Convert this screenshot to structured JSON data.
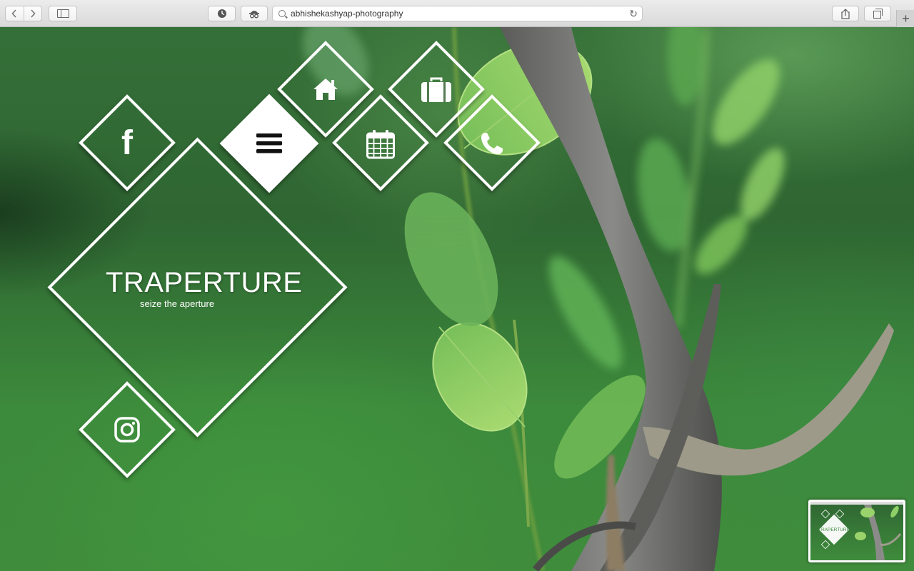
{
  "browser": {
    "url": "abhishekashyap-photography",
    "back_icon": "chevron-left-icon",
    "forward_icon": "chevron-right-icon",
    "new_tab_label": "+",
    "reload_glyph": "↻"
  },
  "site": {
    "title": "TRAPERTURE",
    "tagline": "seize the aperture",
    "thumbnail_title": "TRAPERTURE"
  },
  "nav": [
    {
      "name": "home",
      "icon": "home-icon"
    },
    {
      "name": "portfolio",
      "icon": "briefcase-icon"
    },
    {
      "name": "menu",
      "icon": "hamburger-menu-icon",
      "active": true
    },
    {
      "name": "events",
      "icon": "calendar-icon"
    },
    {
      "name": "contact",
      "icon": "phone-icon"
    }
  ],
  "social": [
    {
      "name": "facebook",
      "icon": "facebook-icon",
      "glyph": "f"
    },
    {
      "name": "instagram",
      "icon": "instagram-icon"
    }
  ],
  "colors": {
    "accent": "#ffffff",
    "background_green": "#3a7d3a",
    "toolbar": "#e3e3e3"
  }
}
